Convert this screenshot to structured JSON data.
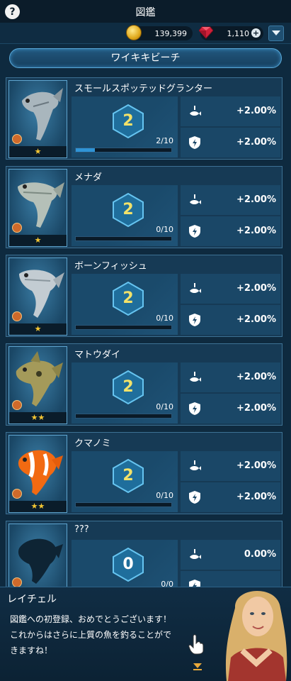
{
  "header": {
    "title": "図鑑",
    "help_label": "?"
  },
  "currency": {
    "coins": "139,399",
    "gems": "1,110",
    "plus": "+"
  },
  "area": {
    "name": "ワイキキビーチ"
  },
  "fish": [
    {
      "name": "スモールスポッテッドグランター",
      "level": "2",
      "progress": "2/10",
      "progress_fraction": 0.2,
      "stars": "★",
      "bonus1": "+2.00%",
      "bonus2": "+2.00%"
    },
    {
      "name": "メナダ",
      "level": "2",
      "progress": "0/10",
      "progress_fraction": 0,
      "stars": "★",
      "bonus1": "+2.00%",
      "bonus2": "+2.00%"
    },
    {
      "name": "ボーンフィッシュ",
      "level": "2",
      "progress": "0/10",
      "progress_fraction": 0,
      "stars": "★",
      "bonus1": "+2.00%",
      "bonus2": "+2.00%"
    },
    {
      "name": "マトウダイ",
      "level": "2",
      "progress": "0/10",
      "progress_fraction": 0,
      "stars": "★★",
      "bonus1": "+2.00%",
      "bonus2": "+2.00%"
    },
    {
      "name": "クマノミ",
      "level": "2",
      "progress": "0/10",
      "progress_fraction": 0,
      "stars": "★★",
      "bonus1": "+2.00%",
      "bonus2": "+2.00%"
    },
    {
      "name": "???",
      "level": "0",
      "progress": "0/0",
      "progress_fraction": 0,
      "stars": "",
      "bonus1": "0.00%",
      "bonus2": ""
    }
  ],
  "dialog": {
    "speaker": "レイチェル",
    "line1": "図鑑への初登録、おめでとうございます！",
    "line2": "これからはさらに上質の魚を釣ることがで",
    "line3": "きますね！"
  },
  "colors": {
    "accent": "#2f94d6",
    "level_text": "#f2e26a",
    "star": "#f5c633",
    "panel": "#163a55"
  },
  "icons": {
    "help": "help-icon",
    "coin": "coin-icon",
    "gem": "gem-icon",
    "dropdown": "chevron-down-icon",
    "catch_bonus": "fish-hook-icon",
    "power_bonus": "shield-bolt-icon"
  }
}
